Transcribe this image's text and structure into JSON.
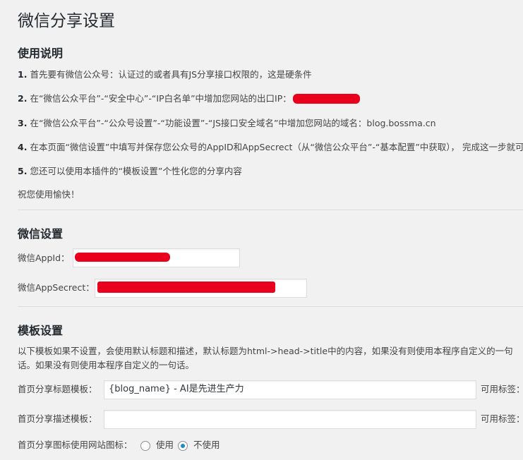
{
  "page_title": "微信分享设置",
  "usage": {
    "heading": "使用说明",
    "steps": [
      {
        "num": "1.",
        "text": "首先要有微信公众号：认证过的或者具有JS分享接口权限的，这是硬条件"
      },
      {
        "num": "2.",
        "text": "在“微信公众平台”-“安全中心”-“IP白名单”中增加您网站的出口IP："
      },
      {
        "num": "3.",
        "text": "在“微信公众平台”-“公众号设置”-“功能设置”-“JS接口安全域名”中增加您网站的域名：blog.bossma.cn"
      },
      {
        "num": "4.",
        "text": "在本页面“微信设置”中填写并保存您公众号的AppID和AppSecrect（从“微信公众平台”-“基本配置”中获取），  完成这一步就可"
      },
      {
        "num": "5.",
        "text": "您还可以使用本插件的“模板设置”个性化您的分享内容"
      }
    ],
    "closing": "祝您使用愉快！"
  },
  "wechat": {
    "heading": "微信设置",
    "appid_label": "微信AppId：",
    "appid_value": "",
    "appsecret_label": "微信AppSecrect：",
    "appsecret_value": ""
  },
  "template": {
    "heading": "模板设置",
    "description": "以下模板如果不设置，会使用默认标题和描述，默认标题为html->head->title中的内容，如果没有则使用本程序自定义的一句话。如果没有则使用本程序自定义的一句话。",
    "title_label": "首页分享标题模板：",
    "title_value": "{blog_name} - AI是先进生产力",
    "desc_label": "首页分享描述模板：",
    "desc_value": "",
    "available_tags": "可用标签：",
    "icon_label": "首页分享图标使用网站图标：",
    "icon_options": [
      "使用",
      "不使用"
    ],
    "icon_selected": "不使用"
  },
  "colors": {
    "redaction": "#e8001c",
    "radio_accent": "#1e8cbe",
    "background": "#f1f1f1"
  }
}
